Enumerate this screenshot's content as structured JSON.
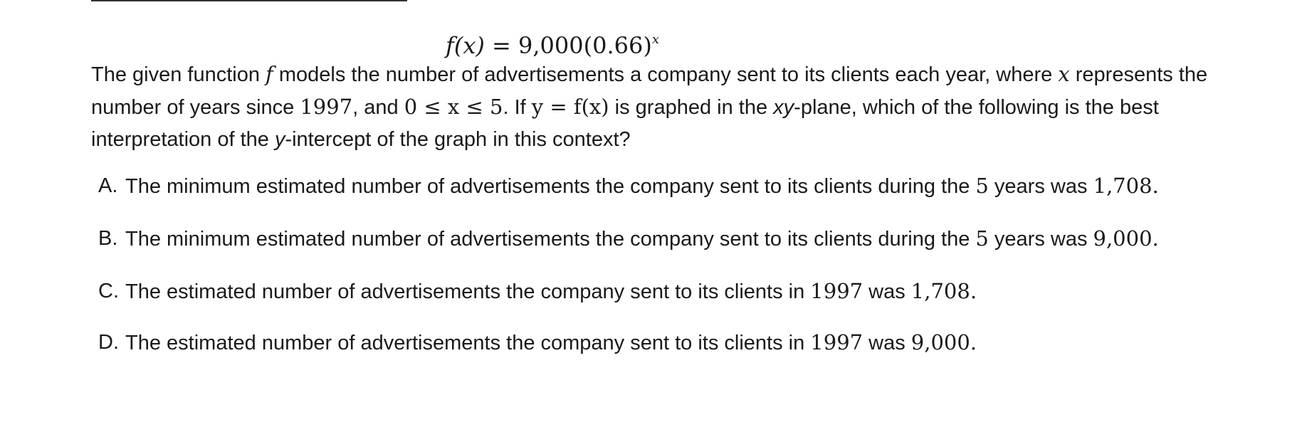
{
  "equation": {
    "lhs": "f(x)",
    "equals": "=",
    "rhs": "9,000(0.66)",
    "exponent": "x"
  },
  "stem": {
    "p1": "The given function ",
    "f": "f",
    "p2": " models the number of advertisements a company sent to its clients each year, where ",
    "x": "x",
    "p3": " represents the number of years since ",
    "year": "1997",
    "p4": ", and ",
    "range": "0 ≤ x ≤ 5",
    "p5": ". If ",
    "yfx": "y = f(x)",
    "p6": " is graphed in the ",
    "xy": "xy",
    "p7": "-plane, which of the following is the best interpretation of the ",
    "y": "y",
    "p8": "-intercept of the graph in this context?"
  },
  "choices": [
    {
      "letter": "A.",
      "text": "The minimum estimated number of advertisements the company sent to its clients during the ",
      "num": "5",
      "text2": " years was ",
      "val": "1,708",
      "end": "."
    },
    {
      "letter": "B.",
      "text": "The minimum estimated number of advertisements the company sent to its clients during the ",
      "num": "5",
      "text2": " years was ",
      "val": "9,000",
      "end": "."
    },
    {
      "letter": "C.",
      "text": "The estimated number of advertisements the company sent to its clients in ",
      "num": "1997",
      "text2": " was ",
      "val": "1,708",
      "end": "."
    },
    {
      "letter": "D.",
      "text": "The estimated number of advertisements the company sent to its clients in ",
      "num": "1997",
      "text2": " was ",
      "val": "9,000",
      "end": "."
    }
  ]
}
